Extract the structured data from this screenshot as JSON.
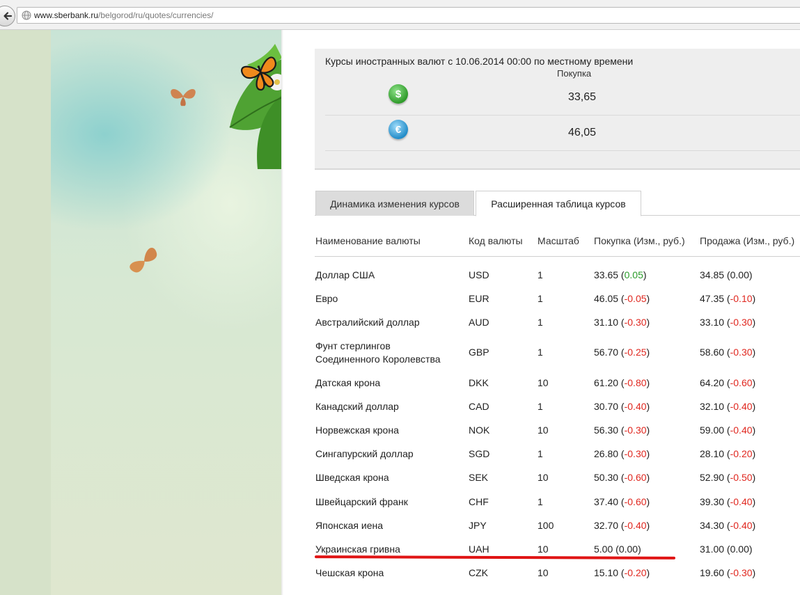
{
  "browser": {
    "url_host": "www.sberbank.ru",
    "url_path": "/belgorod/ru/quotes/currencies/"
  },
  "rates_box": {
    "title": "Курсы иностранных валют с 10.06.2014 00:00 по местному времени",
    "column_label": "Покупка",
    "rows": [
      {
        "icon": "dollar-coin-icon",
        "symbol": "$",
        "value": "33,65"
      },
      {
        "icon": "euro-coin-icon",
        "symbol": "€",
        "value": "46,05"
      }
    ]
  },
  "tabs": [
    {
      "label": "Динамика изменения курсов",
      "active": false
    },
    {
      "label": "Расширенная таблица курсов",
      "active": true
    }
  ],
  "table": {
    "headers": [
      "Наименование валюты",
      "Код валюты",
      "Масштаб",
      "Покупка (Изм., руб.)",
      "Продажа (Изм., руб.)"
    ],
    "rows": [
      {
        "name": "Доллар США",
        "code": "USD",
        "scale": "1",
        "buy": "33.65",
        "buy_chg": "0.05",
        "buy_dir": "pos",
        "sell": "34.85",
        "sell_chg": "0.00",
        "sell_dir": "zero"
      },
      {
        "name": "Евро",
        "code": "EUR",
        "scale": "1",
        "buy": "46.05",
        "buy_chg": "-0.05",
        "buy_dir": "neg",
        "sell": "47.35",
        "sell_chg": "-0.10",
        "sell_dir": "neg"
      },
      {
        "name": "Австралийский доллар",
        "code": "AUD",
        "scale": "1",
        "buy": "31.10",
        "buy_chg": "-0.30",
        "buy_dir": "neg",
        "sell": "33.10",
        "sell_chg": "-0.30",
        "sell_dir": "neg"
      },
      {
        "name": "Фунт стерлингов",
        "name2": "Соединенного Королевства",
        "code": "GBP",
        "scale": "1",
        "buy": "56.70",
        "buy_chg": "-0.25",
        "buy_dir": "neg",
        "sell": "58.60",
        "sell_chg": "-0.30",
        "sell_dir": "neg"
      },
      {
        "name": "Датская крона",
        "code": "DKK",
        "scale": "10",
        "buy": "61.20",
        "buy_chg": "-0.80",
        "buy_dir": "neg",
        "sell": "64.20",
        "sell_chg": "-0.60",
        "sell_dir": "neg"
      },
      {
        "name": "Канадский доллар",
        "code": "CAD",
        "scale": "1",
        "buy": "30.70",
        "buy_chg": "-0.40",
        "buy_dir": "neg",
        "sell": "32.10",
        "sell_chg": "-0.40",
        "sell_dir": "neg"
      },
      {
        "name": "Норвежская крона",
        "code": "NOK",
        "scale": "10",
        "buy": "56.30",
        "buy_chg": "-0.30",
        "buy_dir": "neg",
        "sell": "59.00",
        "sell_chg": "-0.40",
        "sell_dir": "neg"
      },
      {
        "name": "Сингапурский доллар",
        "code": "SGD",
        "scale": "1",
        "buy": "26.80",
        "buy_chg": "-0.30",
        "buy_dir": "neg",
        "sell": "28.10",
        "sell_chg": "-0.20",
        "sell_dir": "neg"
      },
      {
        "name": "Шведская крона",
        "code": "SEK",
        "scale": "10",
        "buy": "50.30",
        "buy_chg": "-0.60",
        "buy_dir": "neg",
        "sell": "52.90",
        "sell_chg": "-0.50",
        "sell_dir": "neg"
      },
      {
        "name": "Швейцарский франк",
        "code": "CHF",
        "scale": "1",
        "buy": "37.40",
        "buy_chg": "-0.60",
        "buy_dir": "neg",
        "sell": "39.30",
        "sell_chg": "-0.40",
        "sell_dir": "neg"
      },
      {
        "name": "Японская иена",
        "code": "JPY",
        "scale": "100",
        "buy": "32.70",
        "buy_chg": "-0.40",
        "buy_dir": "neg",
        "sell": "34.30",
        "sell_chg": "-0.40",
        "sell_dir": "neg"
      },
      {
        "name": "Украинская гривна",
        "code": "UAH",
        "scale": "10",
        "buy": "5.00",
        "buy_chg": "0.00",
        "buy_dir": "zero",
        "sell": "31.00",
        "sell_chg": "0.00",
        "sell_dir": "zero"
      },
      {
        "name": "Чешская крона",
        "code": "CZK",
        "scale": "10",
        "buy": "15.10",
        "buy_chg": "-0.20",
        "buy_dir": "neg",
        "sell": "19.60",
        "sell_chg": "-0.30",
        "sell_dir": "neg"
      }
    ]
  },
  "colors": {
    "positive": "#2a9c2a",
    "negative": "#e0271f",
    "annotation_underline": "#e01414"
  }
}
